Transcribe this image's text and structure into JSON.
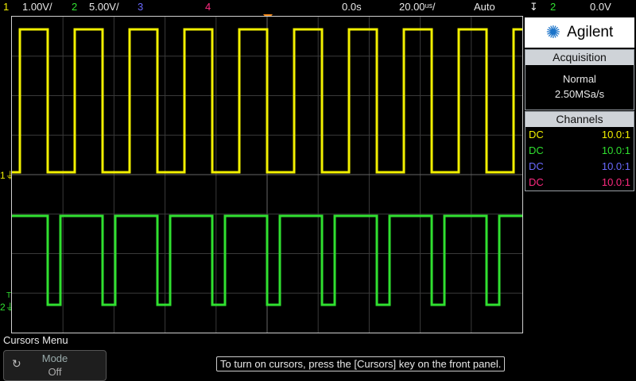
{
  "topbar": {
    "ch1_num": "1",
    "ch1_scale": "1.00V/",
    "ch2_num": "2",
    "ch2_scale": "5.00V/",
    "ch3_num": "3",
    "ch4_num": "4",
    "time_delay": "0.0s",
    "time_scale": "20.00ᵘˢ/",
    "trigger_mode": "Auto",
    "trigger_symbol": "↧",
    "trigger_source": "2",
    "trigger_level": "0.0V"
  },
  "brand": {
    "name": "Agilent"
  },
  "acquisition": {
    "header": "Acquisition",
    "mode": "Normal",
    "rate": "2.50MSa/s"
  },
  "channels": {
    "header": "Channels",
    "rows": [
      {
        "coupling": "DC",
        "probe": "10.0:1",
        "color": "#f2f000"
      },
      {
        "coupling": "DC",
        "probe": "10.0:1",
        "color": "#30e030"
      },
      {
        "coupling": "DC",
        "probe": "10.0:1",
        "color": "#6a6aff"
      },
      {
        "coupling": "DC",
        "probe": "10.0:1",
        "color": "#ff2a80"
      }
    ]
  },
  "markers": {
    "ch1": "1",
    "ch2": "2",
    "trig": "T"
  },
  "menu": {
    "title": "Cursors Menu",
    "softkey_label": "Mode",
    "softkey_value": "Off"
  },
  "hint": "To turn on cursors, press the [Cursors] key on the front panel.",
  "colors": {
    "ch1": "#f2f000",
    "ch2": "#30e030",
    "grid": "#3a3a3a",
    "trigger": "#ff8c1a"
  }
}
